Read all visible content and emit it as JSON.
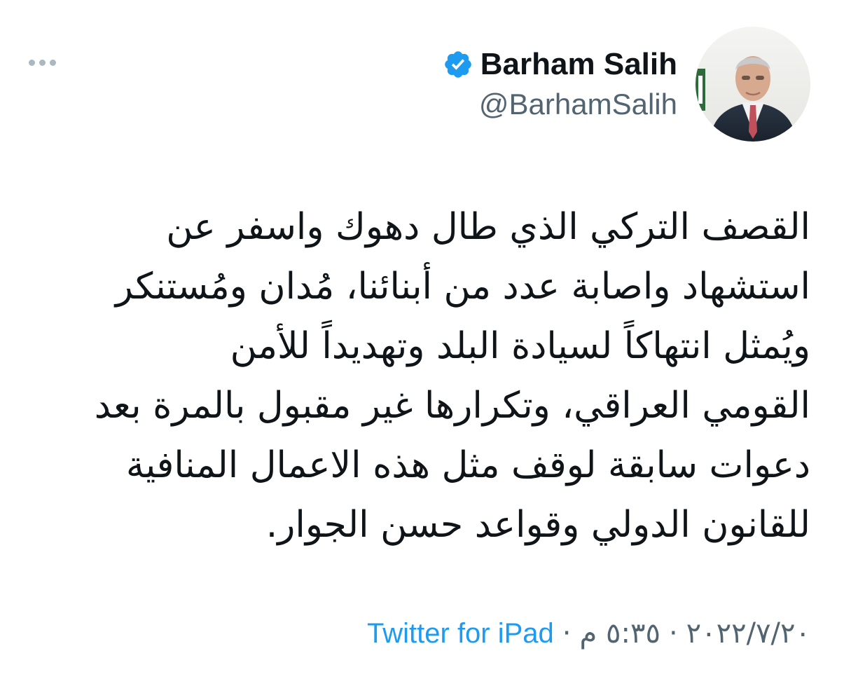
{
  "header": {
    "display_name": "Barham Salih",
    "handle": "@BarhamSalih",
    "verified_icon": "verified-badge-icon",
    "more_icon": "more-horizontal-icon",
    "verified_color": "#1d9bf0"
  },
  "tweet": {
    "lines": [
      "القصف التركي الذي طال دهوك واسفر عن",
      "استشهاد واصابة عدد من أبنائنا، مُدان ومُستنكر",
      "ويُمثل انتهاكاً لسيادة البلد وتهديداً للأمن",
      "القومي العراقي، وتكرارها غير مقبول بالمرة بعد",
      "دعوات سابقة لوقف مثل هذه الاعمال المنافية",
      "للقانون الدولي وقواعد حسن الجوار."
    ]
  },
  "meta": {
    "date": "٢٠٢٢/٧/٢٠",
    "separator": "·",
    "time": "٥:٣٥ م",
    "source": "Twitter for iPad",
    "source_color": "#1d9bf0"
  }
}
